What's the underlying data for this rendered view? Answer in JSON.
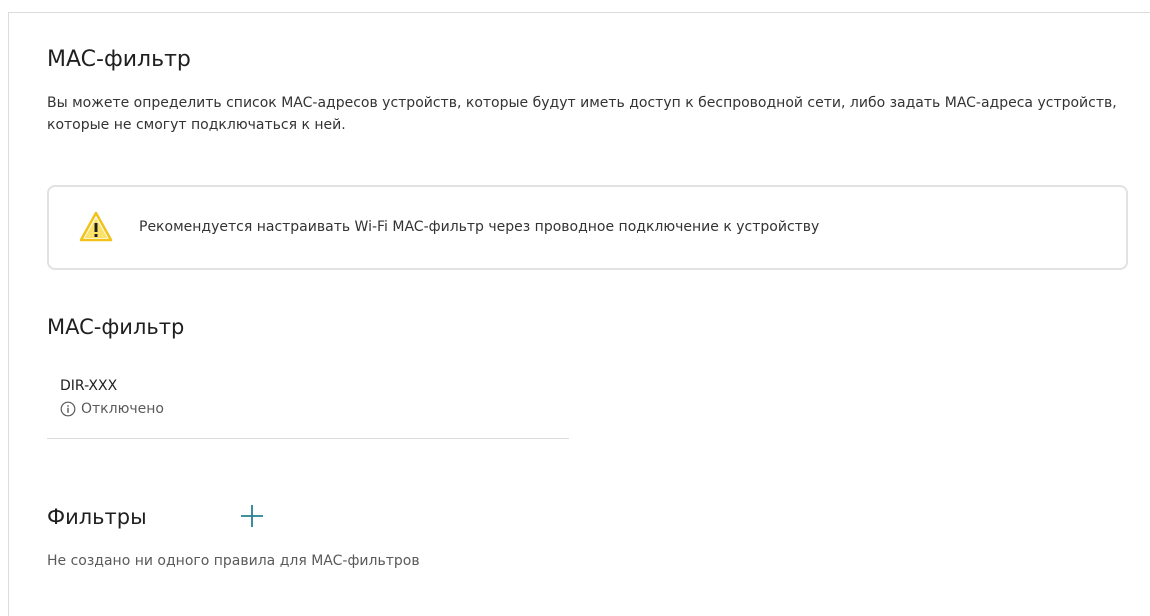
{
  "page": {
    "title": "MAC-фильтр",
    "description": "Вы можете определить список MAC-адресов устройств, которые будут иметь доступ к беспроводной сети, либо задать MAC-адреса устройств, которые не смогут подключаться к ней."
  },
  "warning": {
    "icon": "warning-triangle-icon",
    "text": "Рекомендуется настраивать Wi-Fi MAC-фильтр через проводное подключение к устройству",
    "icon_color": "#f2c21b"
  },
  "mac_filter_section": {
    "title": "MAC-фильтр",
    "entries": [
      {
        "name": "DIR-XXX",
        "status_icon": "info-icon",
        "status": "Отключено"
      }
    ]
  },
  "filters_section": {
    "title": "Фильтры",
    "add_icon": "plus-icon",
    "empty_message": "Не создано ни одного правила для MAC-фильтров"
  },
  "colors": {
    "accent": "#2a7f8f",
    "border": "#e2e2e2",
    "text": "#1f1f1f",
    "muted": "#5a5a5a"
  }
}
